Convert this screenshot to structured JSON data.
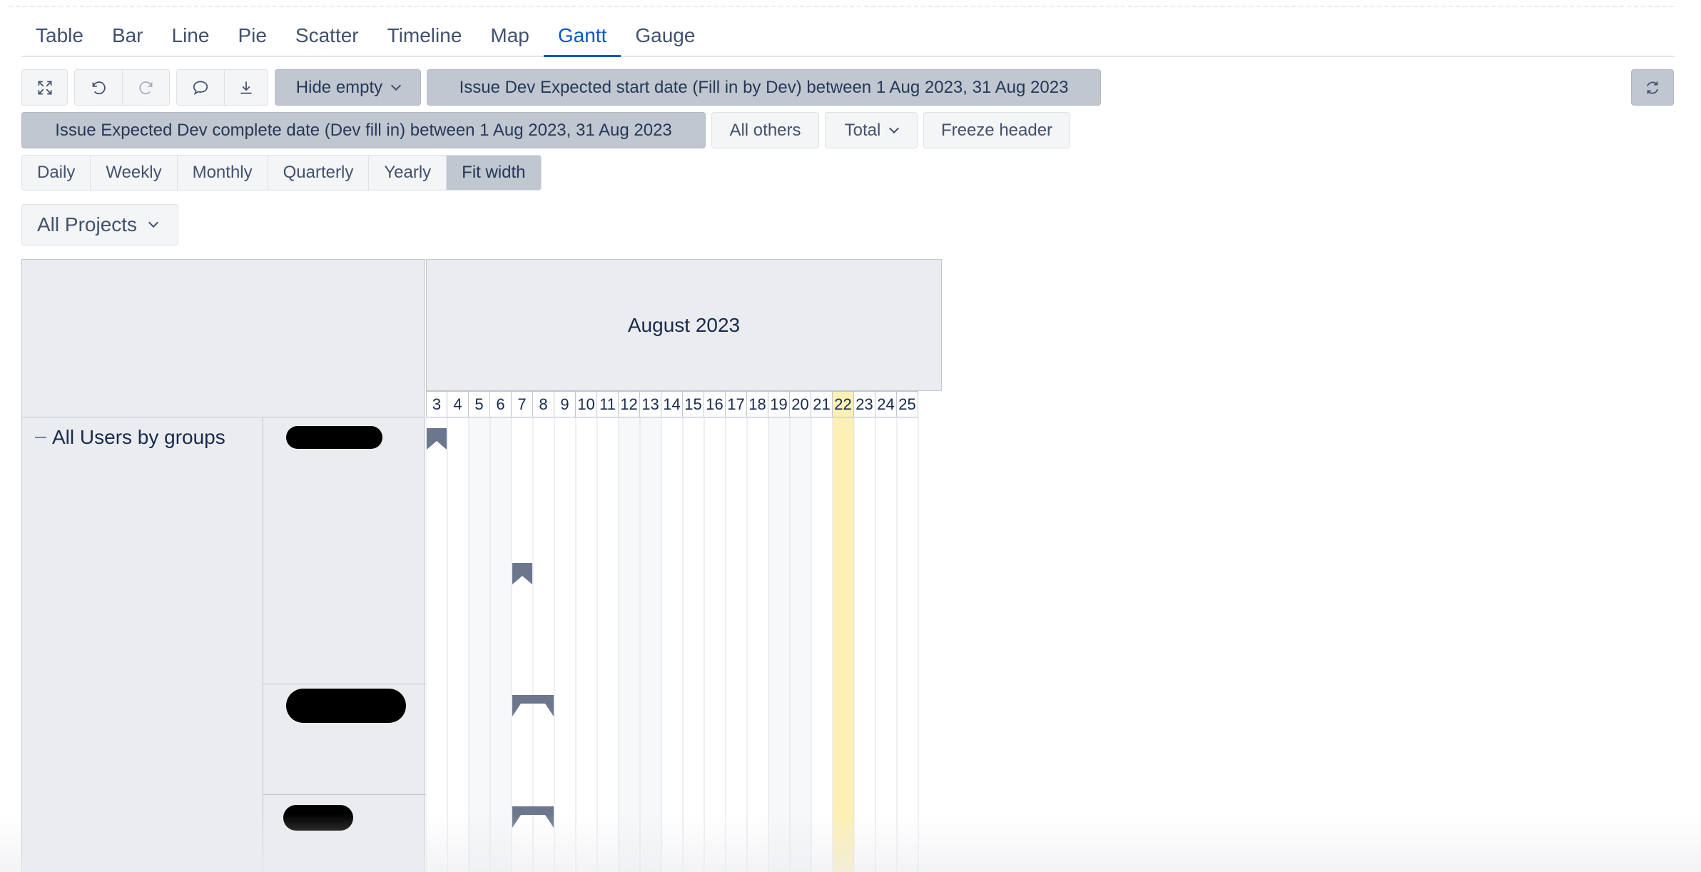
{
  "tabs": [
    "Table",
    "Bar",
    "Line",
    "Pie",
    "Scatter",
    "Timeline",
    "Map",
    "Gantt",
    "Gauge"
  ],
  "active_tab": "Gantt",
  "toolbar": {
    "hide_empty": "Hide empty",
    "filter_start": "Issue Dev Expected start date (Fill in by Dev) between 1 Aug 2023, 31 Aug 2023",
    "filter_complete": "Issue Expected Dev complete date (Dev fill in) between 1 Aug 2023, 31 Aug 2023",
    "all_others": "All others",
    "total": "Total",
    "freeze_header": "Freeze header"
  },
  "scale": {
    "options": [
      "Daily",
      "Weekly",
      "Monthly",
      "Quarterly",
      "Yearly",
      "Fit width"
    ],
    "selected": "Fit width"
  },
  "projects_select": "All Projects",
  "gantt": {
    "month": "August 2023",
    "days": [
      "3",
      "4",
      "5",
      "6",
      "7",
      "8",
      "9",
      "10",
      "11",
      "12",
      "13",
      "14",
      "15",
      "16",
      "17",
      "18",
      "19",
      "20",
      "21",
      "22",
      "23",
      "24",
      "25"
    ],
    "today": "22",
    "group_label": "All Users by groups",
    "bars": [
      {
        "start_day": "3",
        "end_day": "3"
      },
      {
        "start_day": "7",
        "end_day": "7"
      },
      {
        "start_day": "7",
        "end_day": "8"
      },
      {
        "start_day": "7",
        "end_day": "8"
      }
    ]
  },
  "colors": {
    "accent": "#0c57c8",
    "bar": "#6b778c",
    "today": "#fdf0b4",
    "header_bg": "#ebecf0"
  }
}
